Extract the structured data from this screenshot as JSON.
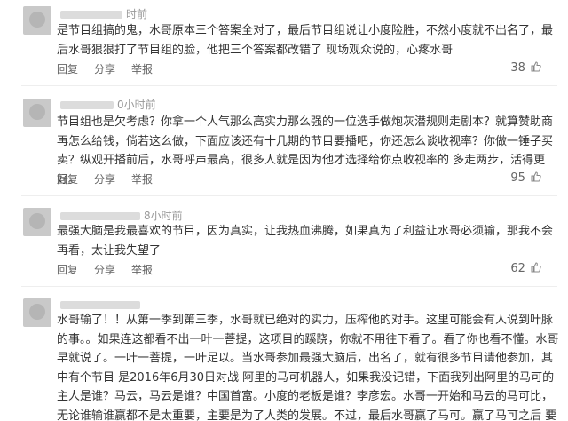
{
  "actions": {
    "reply": "回复",
    "share": "分享",
    "report": "举报"
  },
  "comments": [
    {
      "time": "时前",
      "text": "是节目组搞的鬼，水哥原本三个答案全对了，最后节目组说让小度险胜，不然小度就不出名了，最后水哥狠狠打了节目组的脸，他把三个答案都改错了 现场观众说的，心疼水哥",
      "likes": "38"
    },
    {
      "time": "0小时前",
      "text": "节目组也是欠考虑？你拿一个人气那么高实力那么强的一位选手做炮灰潜规则走剧本？就算赞助商再怎么给钱，倘若这么做，下面应该还有十几期的节目要播吧，你还怎么谈收视率？你做一锤子买卖？纵观开播前后，水哥呼声最高，很多人就是因为他才选择给你点收视率的 多走两步，活得更好。",
      "likes": "95"
    },
    {
      "time": "8小时前",
      "text": "最强大脑是我最喜欢的节目，因为真实，让我热血沸腾，如果真为了利益让水哥必须输，那我不会再看，太让我失望了",
      "likes": "62"
    },
    {
      "time": "",
      "text": "水哥输了！！从第一季到第三季，水哥就已绝对的实力，压榨他的对手。这里可能会有人说到叶脉的事。。如果连这都看不出一叶一菩提，这项目的蹊跷，你就不用往下看了。看了你也看不懂。水哥早就说了。一叶一菩提，一叶足以。当水哥参加最强大脑后，出名了，就有很多节目请他参加，其中有个节目 是2016年6月30日对战 阿里的马可机器人，如果我没记错，下面我列出阿里的马可的主人是谁？马云，马云是谁？中国首富。小度的老板是谁？李彦宏。水哥一开始和马云的马可比，无论谁输谁赢都不是太重要，主要是为了人类的发展。不过，最后水哥赢了马可。赢了马可之后 要跟小度",
      "likes": ""
    }
  ]
}
